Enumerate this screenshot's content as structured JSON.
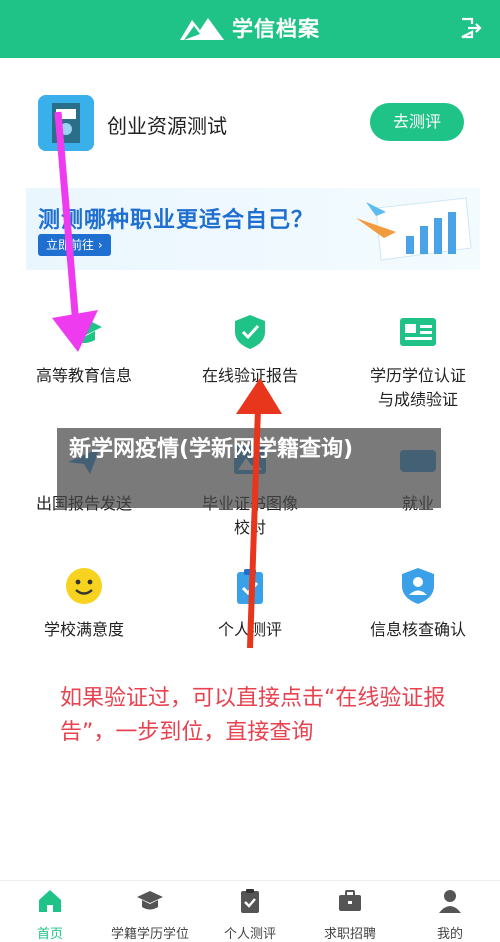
{
  "header": {
    "title": "学信档案"
  },
  "card": {
    "title": "创业资源测试",
    "button": "去测评"
  },
  "banner": {
    "headline": "测测哪种职业更适合自己？",
    "button": "立即前往 ›"
  },
  "grid": {
    "items": [
      {
        "label": "高等教育信息",
        "icon": "graduation-cap-icon"
      },
      {
        "label": "在线验证报告",
        "icon": "shield-check-icon"
      },
      {
        "label": "学历学位认证\n与成绩验证",
        "icon": "id-card-icon"
      },
      {
        "label": "出国报告发送",
        "icon": "plane-icon"
      },
      {
        "label": "毕业证书图像\n校对",
        "icon": "image-icon"
      },
      {
        "label": "就业",
        "icon": "offer-icon"
      },
      {
        "label": "学校满意度",
        "icon": "smile-icon"
      },
      {
        "label": "个人测评",
        "icon": "clipboard-check-icon"
      },
      {
        "label": "信息核查确认",
        "icon": "user-shield-icon"
      }
    ]
  },
  "note": "如果验证过，可以直接点击“在线验证报告”，一步到位，直接查询",
  "overlay": {
    "text": "新学网疫情(学新网学籍查询)"
  },
  "tabbar": {
    "tabs": [
      {
        "label": "首页",
        "icon": "home-icon",
        "active": true
      },
      {
        "label": "学籍学历学位",
        "icon": "graduation-cap-icon"
      },
      {
        "label": "个人测评",
        "icon": "clipboard-check-icon"
      },
      {
        "label": "求职招聘",
        "icon": "briefcase-icon"
      },
      {
        "label": "我的",
        "icon": "user-icon"
      }
    ]
  },
  "colors": {
    "brand": "#20c387",
    "note": "#e8414f",
    "banner_text": "#1f6fd0",
    "arrow_pink": "#ee3bf0",
    "arrow_red": "#e8361c"
  }
}
